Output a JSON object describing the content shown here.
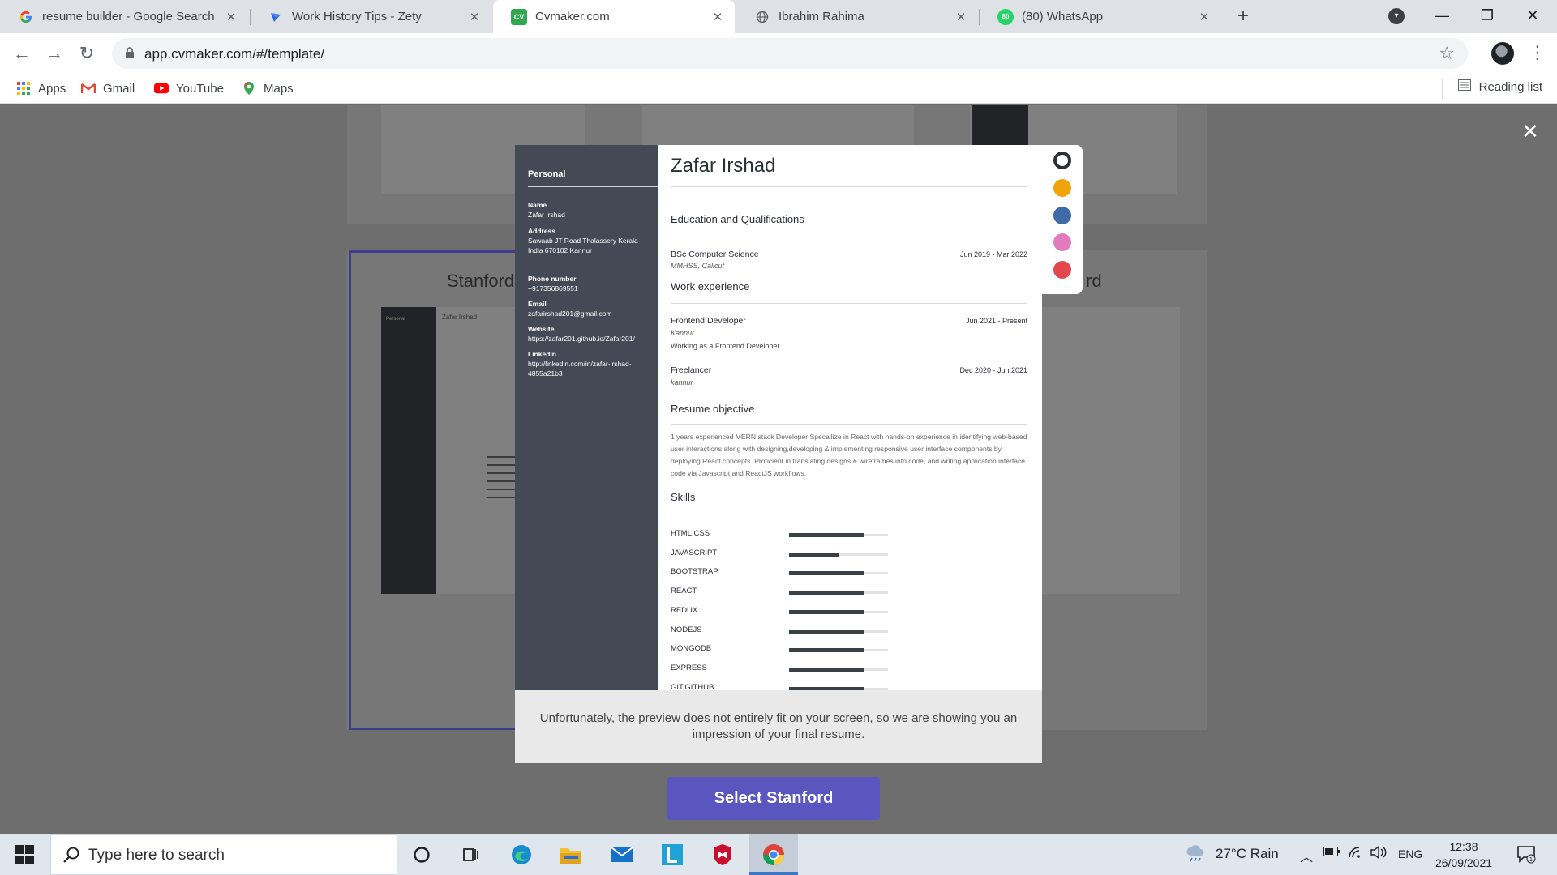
{
  "browser": {
    "tabs": [
      {
        "title": "resume builder - Google Search",
        "icon": "google-icon"
      },
      {
        "title": "Work History Tips - Zety",
        "icon": "zety-icon"
      },
      {
        "title": "Cvmaker.com",
        "icon": "cv-icon",
        "favicon_text": "CV"
      },
      {
        "title": "Ibrahim Rahima",
        "icon": "globe-icon"
      },
      {
        "title": "(80) WhatsApp",
        "icon": "whatsapp-icon",
        "badge": "80"
      }
    ],
    "url": "app.cvmaker.com/#/template/",
    "bookmarks": [
      "Apps",
      "Gmail",
      "YouTube",
      "Maps"
    ],
    "reading_list": "Reading list"
  },
  "background": {
    "left_label": "Stanford",
    "right_label": "rd",
    "thumb_name": "Zafar Irshad",
    "thumb_personal": "Personal"
  },
  "resume": {
    "sidebar_title": "Personal",
    "personal": [
      {
        "label": "Name",
        "value": "Zafar Irshad"
      },
      {
        "label": "Address",
        "value": "Sawaab JT Road Thalassery Kerala India 670102 Kannur"
      },
      {
        "label": "Phone number",
        "value": "+917356869551"
      },
      {
        "label": "Email",
        "value": "zafarirshad201@gmail.com"
      },
      {
        "label": "Website",
        "value": "https://zafar201.github.io/Zafar201/"
      },
      {
        "label": "LinkedIn",
        "value": "http://linkedin.com/in/zafar-irshad-4855a21b3"
      }
    ],
    "name": "Zafar Irshad",
    "education_title": "Education and Qualifications",
    "education": [
      {
        "degree": "BSc Computer Science",
        "school": "MMHSS, Calicut",
        "dates": "Jun 2019 - Mar 2022"
      }
    ],
    "work_title": "Work experience",
    "work": [
      {
        "role": "Frontend Developer",
        "place": "Kannur",
        "dates": "Jun 2021 - Present",
        "desc": "Working as a Frontend Developer"
      },
      {
        "role": "Freelancer",
        "place": "kannur",
        "dates": "Dec 2020 - Jun 2021",
        "desc": ""
      }
    ],
    "objective_title": "Resume objective",
    "objective": "1 years experienced MERN stack Developer Specailize in React with hands-on experience in identifying web-based user interactions along with designing,developing & implementing responsive user interface components by deploying React concepts. Proficient in translating designs & wireframes into code, and writing application interface code via Javascript and ReactJS workflows.",
    "skills_title": "Skills",
    "skills": [
      {
        "name": "HTML,CSS",
        "level": 0.75
      },
      {
        "name": "JAVASCRIPT",
        "level": 0.5
      },
      {
        "name": "BOOTSTRAP",
        "level": 0.75
      },
      {
        "name": "REACT",
        "level": 0.75
      },
      {
        "name": "REDUX",
        "level": 0.75
      },
      {
        "name": "NODEJS",
        "level": 0.75
      },
      {
        "name": "MONGODB",
        "level": 0.75
      },
      {
        "name": "EXPRESS",
        "level": 0.75
      },
      {
        "name": "GIT,GITHUB",
        "level": 0.75
      }
    ]
  },
  "palette": {
    "colors": [
      "#ffffff",
      "#f0a30a",
      "#3e6aa8",
      "#e27bbd",
      "#e2474b"
    ],
    "selected": 0
  },
  "notice": "Unfortunately, the preview does not entirely fit on your screen, so we are showing you an impression of your final resume.",
  "select_button": "Select Stanford",
  "taskbar": {
    "search_placeholder": "Type here to search",
    "weather": "27°C  Rain",
    "language": "ENG",
    "time": "12:38",
    "date": "26/09/2021"
  }
}
